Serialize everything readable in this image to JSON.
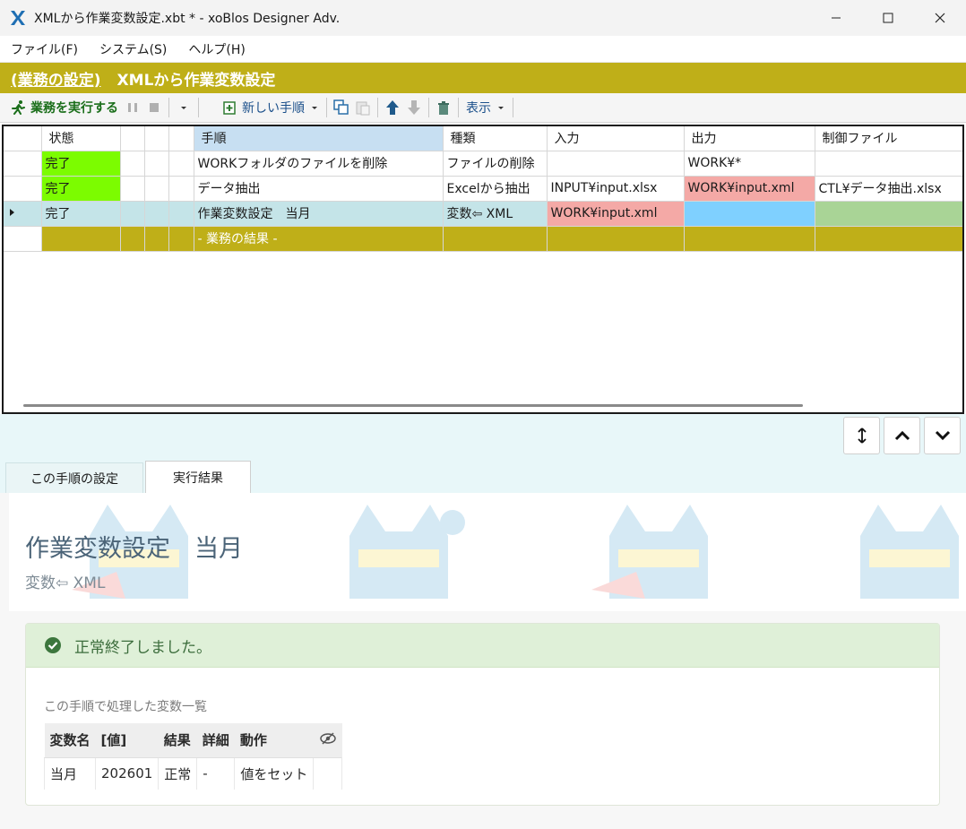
{
  "window": {
    "title": "XMLから作業変数設定.xbt *  - xoBlos Designer Adv.",
    "controls": [
      "minimize-icon",
      "maximize-icon",
      "close-icon"
    ]
  },
  "menu": [
    "ファイル(F)",
    "システム(S)",
    "ヘルプ(H)"
  ],
  "header": {
    "link": "(業務の設定)",
    "title": "XMLから作業変数設定"
  },
  "toolbar": {
    "run": "業務を実行する",
    "new_step": "新しい手順",
    "view": "表示"
  },
  "grid": {
    "columns": [
      "状態",
      "手順",
      "種類",
      "入力",
      "出力",
      "制御ファイル"
    ],
    "rows": [
      {
        "status": "完了",
        "step": "WORKフォルダのファイルを削除",
        "kind": "ファイルの削除",
        "input": "",
        "output": "WORK¥*",
        "control": ""
      },
      {
        "status": "完了",
        "step": "データ抽出",
        "kind": "Excelから抽出",
        "input": "INPUT¥input.xlsx",
        "output": "WORK¥input.xml",
        "control": "CTL¥データ抽出.xlsx"
      },
      {
        "status": "完了",
        "step": "作業変数設定　当月",
        "kind": "変数⇦ XML",
        "input": "WORK¥input.xml",
        "output": "",
        "control": ""
      }
    ],
    "result_row": "- 業務の結果 -"
  },
  "tabs": [
    "この手順の設定",
    "実行結果"
  ],
  "detail": {
    "title": "作業変数設定　当月",
    "subtitle": "変数⇦ XML",
    "alert": "正常終了しました。",
    "list_label": "この手順で処理した変数一覧",
    "var_headers": [
      "変数名",
      "[値]",
      "結果",
      "詳細",
      "動作"
    ],
    "vars": [
      {
        "name": "当月",
        "value": "202601",
        "result": "正常",
        "detail": "-",
        "action": "値をセット"
      }
    ]
  },
  "colors": {
    "gold": "#bfaf18",
    "status_green": "#7cfc00",
    "selected_row": "#c4e4e8",
    "pink": "#f4a9a6",
    "blue": "#7fd0ff",
    "light_green": "#a9d496",
    "alert_bg": "#dff0d8"
  }
}
